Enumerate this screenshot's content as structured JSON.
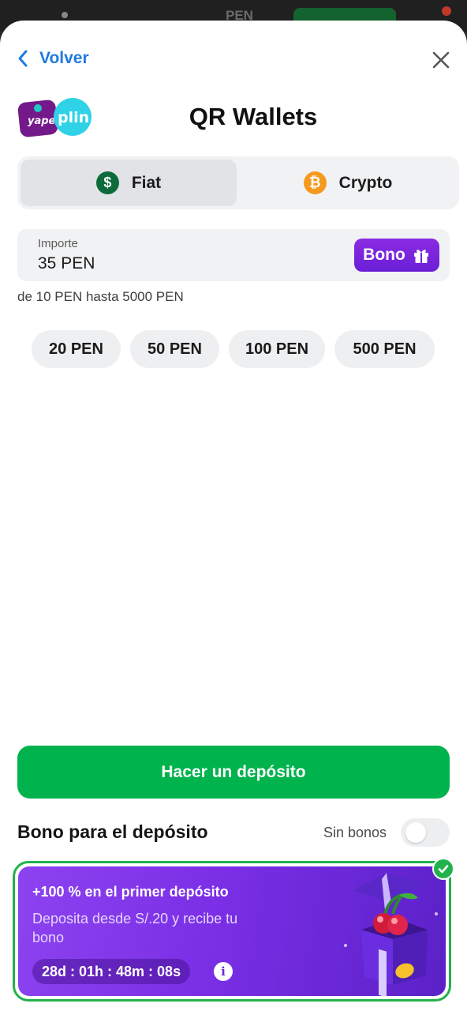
{
  "topbar": {
    "currency": "PEN"
  },
  "nav": {
    "back_label": "Volver"
  },
  "header": {
    "title": "QR Wallets",
    "logo_text_1": "yape",
    "logo_text_2": "plin"
  },
  "tabs": [
    {
      "label": "Fiat",
      "icon": "dollar-icon",
      "color": "#0b6b3a"
    },
    {
      "label": "Crypto",
      "icon": "bitcoin-icon",
      "color": "#f59a1f"
    }
  ],
  "amount": {
    "label": "Importe",
    "value": "35 PEN",
    "bonus_button": "Bono",
    "range_text": "de 10 PEN hasta 5000 PEN"
  },
  "presets": [
    "20 PEN",
    "50 PEN",
    "100 PEN",
    "500 PEN"
  ],
  "deposit_button": "Hacer un depósito",
  "bonus": {
    "heading": "Bono para el depósito",
    "toggle_label": "Sin bonos",
    "toggle_on": false,
    "card_title": "+100 % en el primer depósito",
    "card_subtitle": "Deposita desde S/.20 y recibe tu bono",
    "timer": "28d : 01h : 48m : 08s",
    "selected": true
  },
  "colors": {
    "accent_blue": "#1f7ae0",
    "green": "#00b34d",
    "purple": "#7b2fe6"
  }
}
